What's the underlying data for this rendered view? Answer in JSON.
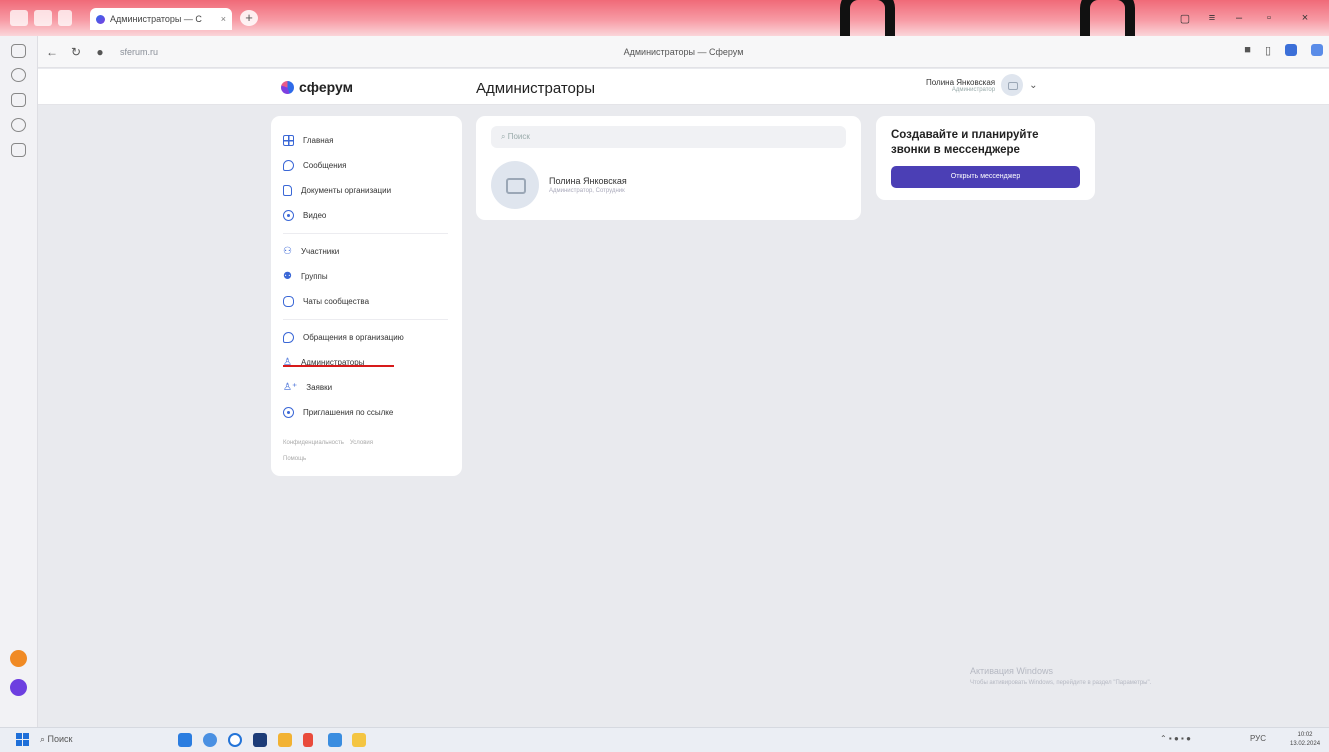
{
  "browser": {
    "tab_title": "Администраторы — С",
    "tab_close": "×",
    "new_tab": "+",
    "url": "sferum.ru",
    "window_title": "Администраторы — Сферум"
  },
  "header": {
    "logo_text": "сферум",
    "page_title": "Администраторы",
    "user_name": "Полина Янковская",
    "user_role": "Администратор"
  },
  "sidebar": {
    "items": [
      {
        "label": "Главная",
        "icon": "home-grid-icon"
      },
      {
        "label": "Сообщения",
        "icon": "message-bubble-icon"
      },
      {
        "label": "Документы организации",
        "icon": "document-icon"
      },
      {
        "label": "Видео",
        "icon": "video-icon"
      },
      {
        "label": "Участники",
        "icon": "members-icon"
      },
      {
        "label": "Группы",
        "icon": "groups-icon"
      },
      {
        "label": "Чаты сообщества",
        "icon": "community-chats-icon"
      },
      {
        "label": "Обращения в организацию",
        "icon": "message-bubble-icon"
      },
      {
        "label": "Администраторы",
        "icon": "admin-person-icon"
      },
      {
        "label": "Заявки",
        "icon": "add-person-icon"
      },
      {
        "label": "Приглашения по ссылке",
        "icon": "link-invite-icon"
      }
    ],
    "footer": {
      "privacy": "Конфиденциальность",
      "terms": "Условия",
      "help": "Помощь"
    }
  },
  "main": {
    "search_placeholder": "Поиск",
    "members": [
      {
        "name": "Полина Янковская",
        "role": "Администратор, Сотрудник"
      }
    ]
  },
  "promo": {
    "title": "Создавайте и планируйте звонки в мессенджере",
    "button": "Открыть мессенджер"
  },
  "watermark": {
    "title": "Активация Windows",
    "text": "Чтобы активировать Windows, перейдите в раздел \"Параметры\"."
  },
  "taskbar": {
    "search": "Поиск",
    "lang": "РУС",
    "time": "10:02",
    "date": "13.02.2024"
  },
  "colors": {
    "accent": "#3a67d6",
    "button": "#4b3fb5",
    "active_underline": "#d71a1a",
    "tab_gradient_top": "#f06a78"
  }
}
